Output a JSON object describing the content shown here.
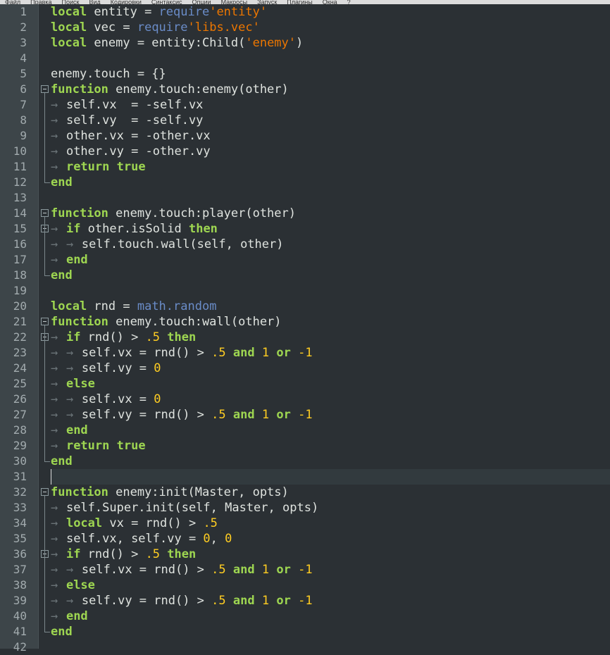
{
  "menu": [
    "Файл",
    "Правка",
    "Поиск",
    "Вид",
    "Кодировки",
    "Синтаксис",
    "Опции",
    "Макросы",
    "Запуск",
    "Плагины",
    "Окна",
    "?"
  ],
  "colors": {
    "background": "#2b3034",
    "gutter": "#3d4549",
    "keyword": "#9ed651",
    "string": "#ec7600",
    "number": "#ffcd22",
    "library": "#6a8cc8",
    "identifier": "#dfe3df"
  },
  "current_line": 31,
  "lines": [
    {
      "n": "1",
      "indent": 0,
      "tokens": [
        [
          "kw",
          "local"
        ],
        [
          "id",
          " entity = "
        ],
        [
          "lib",
          "require"
        ],
        [
          "str",
          "'entity'"
        ]
      ]
    },
    {
      "n": "2",
      "indent": 0,
      "tokens": [
        [
          "kw",
          "local"
        ],
        [
          "id",
          " vec = "
        ],
        [
          "lib",
          "require"
        ],
        [
          "str",
          "'libs.vec'"
        ]
      ]
    },
    {
      "n": "3",
      "indent": 0,
      "tokens": [
        [
          "kw",
          "local"
        ],
        [
          "id",
          " enemy = entity:Child("
        ],
        [
          "str",
          "'enemy'"
        ],
        [
          "id",
          ")"
        ]
      ]
    },
    {
      "n": "4",
      "indent": 0,
      "tokens": []
    },
    {
      "n": "5",
      "indent": 0,
      "tokens": [
        [
          "id",
          "enemy.touch = {}"
        ]
      ]
    },
    {
      "n": "6",
      "indent": 0,
      "fold": "open",
      "tokens": [
        [
          "kw",
          "function"
        ],
        [
          "id",
          " enemy.touch:enemy(other)"
        ]
      ]
    },
    {
      "n": "7",
      "indent": 1,
      "tokens": [
        [
          "id",
          "self.vx  = -self.vx"
        ]
      ]
    },
    {
      "n": "8",
      "indent": 1,
      "tokens": [
        [
          "id",
          "self.vy  = -self.vy"
        ]
      ]
    },
    {
      "n": "9",
      "indent": 1,
      "tokens": [
        [
          "id",
          "other.vx = -other.vx"
        ]
      ]
    },
    {
      "n": "10",
      "indent": 1,
      "tokens": [
        [
          "id",
          "other.vy = -other.vy"
        ]
      ]
    },
    {
      "n": "11",
      "indent": 1,
      "tokens": [
        [
          "kw",
          "return"
        ],
        [
          "id",
          " "
        ],
        [
          "kw",
          "true"
        ]
      ]
    },
    {
      "n": "12",
      "indent": 0,
      "fold": "end",
      "tokens": [
        [
          "kw",
          "end"
        ]
      ]
    },
    {
      "n": "13",
      "indent": 0,
      "tokens": []
    },
    {
      "n": "14",
      "indent": 0,
      "fold": "open",
      "tokens": [
        [
          "kw",
          "function"
        ],
        [
          "id",
          " enemy.touch:player(other)"
        ]
      ]
    },
    {
      "n": "15",
      "indent": 1,
      "fold": "open",
      "tokens": [
        [
          "kw",
          "if"
        ],
        [
          "id",
          " other.isSolid "
        ],
        [
          "kw",
          "then"
        ]
      ]
    },
    {
      "n": "16",
      "indent": 2,
      "tokens": [
        [
          "id",
          "self.touch.wall(self, other)"
        ]
      ]
    },
    {
      "n": "17",
      "indent": 1,
      "tokens": [
        [
          "kw",
          "end"
        ]
      ]
    },
    {
      "n": "18",
      "indent": 0,
      "fold": "end",
      "tokens": [
        [
          "kw",
          "end"
        ]
      ]
    },
    {
      "n": "19",
      "indent": 0,
      "tokens": []
    },
    {
      "n": "20",
      "indent": 0,
      "tokens": [
        [
          "kw",
          "local"
        ],
        [
          "id",
          " rnd = "
        ],
        [
          "lib",
          "math.random"
        ]
      ]
    },
    {
      "n": "21",
      "indent": 0,
      "fold": "open",
      "tokens": [
        [
          "kw",
          "function"
        ],
        [
          "id",
          " enemy.touch:wall(other)"
        ]
      ]
    },
    {
      "n": "22",
      "indent": 1,
      "fold": "open",
      "tokens": [
        [
          "kw",
          "if"
        ],
        [
          "id",
          " rnd() > "
        ],
        [
          "num",
          ".5"
        ],
        [
          "id",
          " "
        ],
        [
          "kw",
          "then"
        ]
      ]
    },
    {
      "n": "23",
      "indent": 2,
      "tokens": [
        [
          "id",
          "self.vx = rnd() > "
        ],
        [
          "num",
          ".5"
        ],
        [
          "id",
          " "
        ],
        [
          "kw",
          "and"
        ],
        [
          "id",
          " "
        ],
        [
          "num",
          "1"
        ],
        [
          "id",
          " "
        ],
        [
          "kw",
          "or"
        ],
        [
          "id",
          " "
        ],
        [
          "num",
          "-1"
        ]
      ]
    },
    {
      "n": "24",
      "indent": 2,
      "tokens": [
        [
          "id",
          "self.vy = "
        ],
        [
          "num",
          "0"
        ]
      ]
    },
    {
      "n": "25",
      "indent": 1,
      "tokens": [
        [
          "kw",
          "else"
        ]
      ]
    },
    {
      "n": "26",
      "indent": 2,
      "tokens": [
        [
          "id",
          "self.vx = "
        ],
        [
          "num",
          "0"
        ]
      ]
    },
    {
      "n": "27",
      "indent": 2,
      "tokens": [
        [
          "id",
          "self.vy = rnd() > "
        ],
        [
          "num",
          ".5"
        ],
        [
          "id",
          " "
        ],
        [
          "kw",
          "and"
        ],
        [
          "id",
          " "
        ],
        [
          "num",
          "1"
        ],
        [
          "id",
          " "
        ],
        [
          "kw",
          "or"
        ],
        [
          "id",
          " "
        ],
        [
          "num",
          "-1"
        ]
      ]
    },
    {
      "n": "28",
      "indent": 1,
      "tokens": [
        [
          "kw",
          "end"
        ]
      ]
    },
    {
      "n": "29",
      "indent": 1,
      "tokens": [
        [
          "kw",
          "return"
        ],
        [
          "id",
          " "
        ],
        [
          "kw",
          "true"
        ]
      ]
    },
    {
      "n": "30",
      "indent": 0,
      "fold": "end",
      "tokens": [
        [
          "kw",
          "end"
        ]
      ]
    },
    {
      "n": "31",
      "indent": 0,
      "tokens": []
    },
    {
      "n": "32",
      "indent": 0,
      "fold": "open",
      "tokens": [
        [
          "kw",
          "function"
        ],
        [
          "id",
          " enemy:init(Master, opts)"
        ]
      ]
    },
    {
      "n": "33",
      "indent": 1,
      "tokens": [
        [
          "id",
          "self.Super.init(self, Master, opts)"
        ]
      ]
    },
    {
      "n": "34",
      "indent": 1,
      "tokens": [
        [
          "kw",
          "local"
        ],
        [
          "id",
          " vx = rnd() > "
        ],
        [
          "num",
          ".5"
        ]
      ]
    },
    {
      "n": "35",
      "indent": 1,
      "tokens": [
        [
          "id",
          "self.vx, self.vy = "
        ],
        [
          "num",
          "0"
        ],
        [
          "id",
          ", "
        ],
        [
          "num",
          "0"
        ]
      ]
    },
    {
      "n": "36",
      "indent": 1,
      "fold": "open",
      "tokens": [
        [
          "kw",
          "if"
        ],
        [
          "id",
          " rnd() > "
        ],
        [
          "num",
          ".5"
        ],
        [
          "id",
          " "
        ],
        [
          "kw",
          "then"
        ]
      ]
    },
    {
      "n": "37",
      "indent": 2,
      "tokens": [
        [
          "id",
          "self.vx = rnd() > "
        ],
        [
          "num",
          ".5"
        ],
        [
          "id",
          " "
        ],
        [
          "kw",
          "and"
        ],
        [
          "id",
          " "
        ],
        [
          "num",
          "1"
        ],
        [
          "id",
          " "
        ],
        [
          "kw",
          "or"
        ],
        [
          "id",
          " "
        ],
        [
          "num",
          "-1"
        ]
      ]
    },
    {
      "n": "38",
      "indent": 1,
      "tokens": [
        [
          "kw",
          "else"
        ]
      ]
    },
    {
      "n": "39",
      "indent": 2,
      "tokens": [
        [
          "id",
          "self.vy = rnd() > "
        ],
        [
          "num",
          ".5"
        ],
        [
          "id",
          " "
        ],
        [
          "kw",
          "and"
        ],
        [
          "id",
          " "
        ],
        [
          "num",
          "1"
        ],
        [
          "id",
          " "
        ],
        [
          "kw",
          "or"
        ],
        [
          "id",
          " "
        ],
        [
          "num",
          "-1"
        ]
      ]
    },
    {
      "n": "40",
      "indent": 1,
      "tokens": [
        [
          "kw",
          "end"
        ]
      ]
    },
    {
      "n": "41",
      "indent": 0,
      "fold": "end",
      "tokens": [
        [
          "kw",
          "end"
        ]
      ]
    },
    {
      "n": "42",
      "indent": 0,
      "tokens": []
    }
  ]
}
